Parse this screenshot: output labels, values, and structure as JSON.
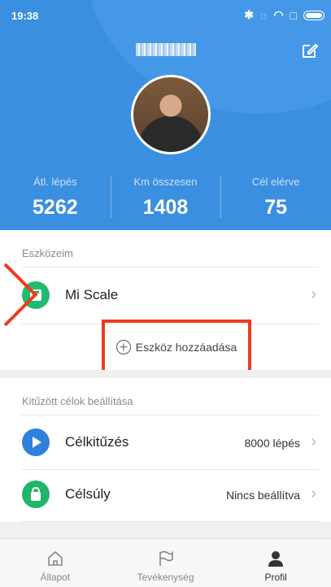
{
  "status_bar": {
    "time": "19:38"
  },
  "profile": {
    "stats": [
      {
        "label": "Átl. lépés",
        "value": "5262"
      },
      {
        "label": "Km összesen",
        "value": "1408"
      },
      {
        "label": "Cél elérve",
        "value": "75"
      }
    ]
  },
  "devices": {
    "title": "Eszközeim",
    "items": [
      {
        "label": "Mi Scale"
      }
    ],
    "add_label": "Eszköz hozzáadása"
  },
  "goals": {
    "title": "Kitűzött célok beállítása",
    "items": [
      {
        "label": "Célkitűzés",
        "value": "8000 lépés"
      },
      {
        "label": "Célsúly",
        "value": "Nincs beállítva"
      }
    ]
  },
  "bottom_nav": {
    "items": [
      {
        "label": "Állapot"
      },
      {
        "label": "Tevékenység"
      },
      {
        "label": "Profil"
      }
    ]
  },
  "colors": {
    "header_blue": "#3b8fe0",
    "scale_green": "#1fba6e",
    "goal_blue": "#2f7fdc",
    "weight_green": "#22b56a",
    "highlight_red": "#ee3b1e"
  }
}
